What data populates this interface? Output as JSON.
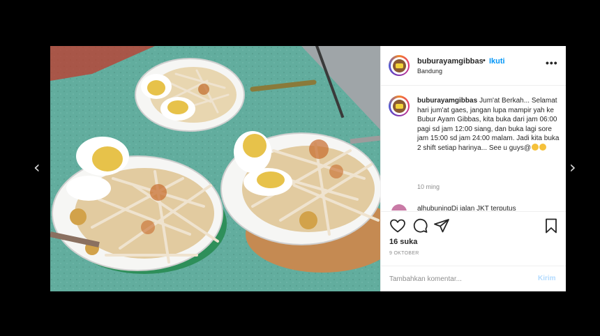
{
  "navigation": {
    "prev_icon": "chevron-left-icon",
    "next_icon": "chevron-right-icon",
    "prev_glyph": "‹",
    "next_glyph": "›"
  },
  "post": {
    "username": "buburayamgibbas",
    "dot": "•",
    "follow_label": "Ikuti",
    "location": "Bandung",
    "more_label": "•••",
    "caption": "Jum'at Berkah... Selamat hari jum'at gaes, jangan lupa mampir yah ke Bubur Ayam Gibbas, kita buka dari jam 06:00 pagi sd jam 12:00 siang, dan buka lagi sore jam 15:00 sd jam 24:00 malam. Jadi kita buka 2 shift setiap harinya... See u guys@",
    "time": "10 ming",
    "next_comment_preview": "alhubuningDi jalan JKT terputus",
    "likes": "16 suka",
    "date": "9 OKTOBER",
    "comment_placeholder": "Tambahkan komentar...",
    "post_label": "Kirim"
  },
  "actions": {
    "like_icon": "heart-icon",
    "comment_icon": "comment-icon",
    "share_icon": "share-icon",
    "save_icon": "bookmark-icon"
  },
  "photo": {
    "subject": "three plates of bubur ayam with shredded chicken and boiled eggs on a green table"
  },
  "colors": {
    "link": "#0095f6",
    "muted": "#8e8e8e",
    "text": "#262626",
    "post_disabled": "#b3dbff",
    "table": "#5fa99a"
  }
}
